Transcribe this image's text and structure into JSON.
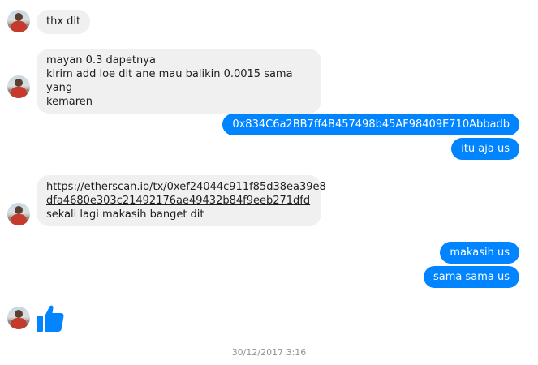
{
  "conversation": {
    "messages": [
      {
        "lines": [
          "thx dit"
        ]
      },
      {
        "lines": [
          "mayan 0.3 dapetnya",
          "kirim add loe  dit ane mau balikin 0.0015 sama yang",
          "kemaren"
        ]
      },
      {
        "lines": [
          "0x834C6a2BB7ff4B457498b45AF98409E710Abbadb"
        ]
      },
      {
        "lines": [
          "itu aja us"
        ]
      },
      {
        "link_lines": [
          "https://etherscan.io/tx/0xef24044c911f85d38ea39e8",
          "dfa4680e303c21492176ae49432b84f9eeb271dfd"
        ],
        "lines": [
          "sekali lagi makasih banget dit"
        ]
      },
      {
        "lines": [
          "makasih us"
        ]
      },
      {
        "lines": [
          "sama sama us"
        ]
      }
    ],
    "reaction_icon": "thumbs-up-icon",
    "timestamp": "30/12/2017 3:16"
  },
  "colors": {
    "outgoing_bubble": "#0084ff",
    "incoming_bubble": "#f1f0f0",
    "timestamp": "#90949c"
  }
}
